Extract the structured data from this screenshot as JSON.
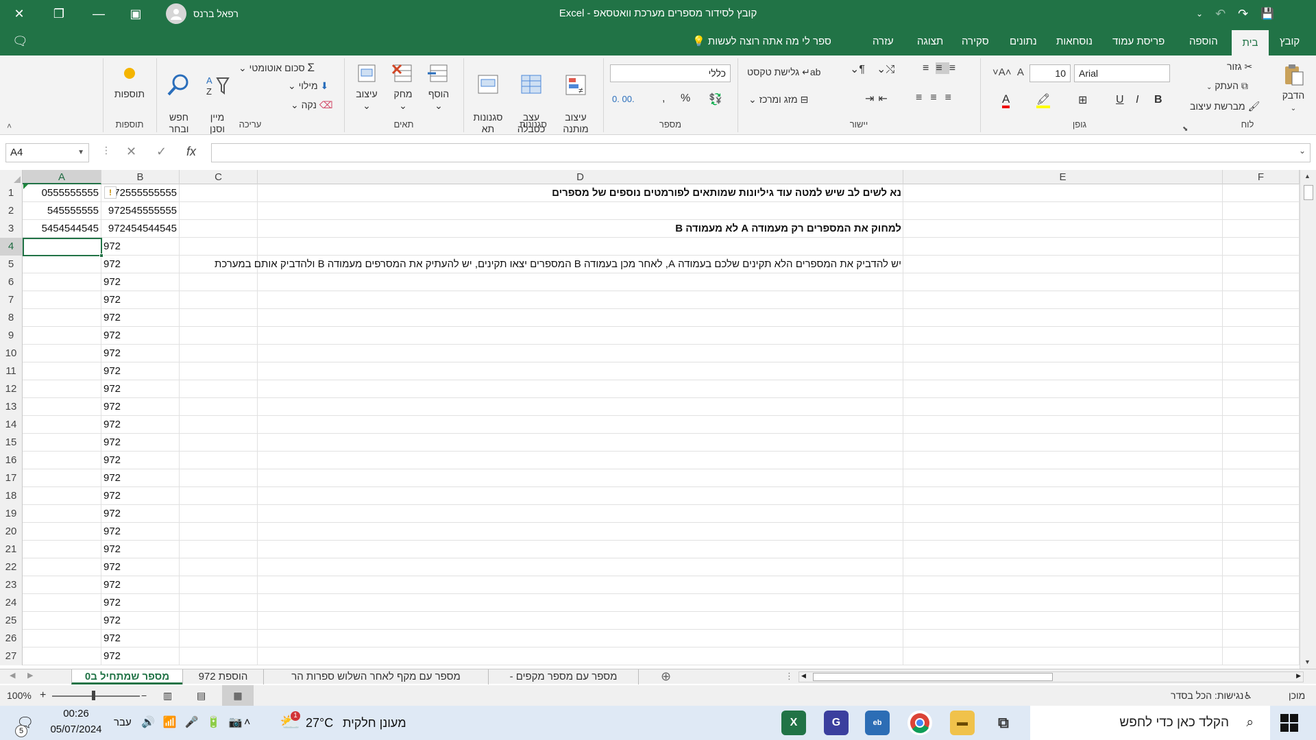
{
  "window": {
    "title": "קובץ לסידור מספרים מערכת וואטסאפ  -  Excel",
    "user": "רפאל ברנס"
  },
  "ribbon_tabs": [
    "קובץ",
    "בית",
    "הוספה",
    "פריסת עמוד",
    "נוסחאות",
    "נתונים",
    "סקירה",
    "תצוגה",
    "עזרה"
  ],
  "active_tab": "בית",
  "tell_me": "ספר לי מה אתה רוצה לעשות",
  "ribbon": {
    "clipboard": {
      "label": "לוח",
      "paste": "הדבק",
      "cut": "גזור",
      "copy": "העתק",
      "format_painter": "מברשת עיצוב"
    },
    "font": {
      "label": "גופן",
      "font_name": "Arial",
      "font_size": "10",
      "bold": "B",
      "italic": "I",
      "underline": "U"
    },
    "alignment": {
      "label": "יישור",
      "wrap_text": "גלישת טקסט",
      "merge_center": "מזג ומרכז"
    },
    "number": {
      "label": "מספר",
      "format": "כללי",
      "percent": "%",
      "comma": ","
    },
    "styles": {
      "label": "סגנונות",
      "conditional": "עיצוב\nמותנה",
      "format_table": "עצב\nכטבלה",
      "cell_styles": "סגנונות\nתא"
    },
    "cells": {
      "label": "תאים",
      "insert": "הוסף",
      "delete": "מחק",
      "format": "עיצוב"
    },
    "editing": {
      "label": "עריכה",
      "autosum": "סכום אוטומטי",
      "fill": "מילוי",
      "clear": "נקה",
      "sort_filter": "מיין\nוסנן",
      "find_select": "חפש\nובחר"
    },
    "addins": {
      "label": "תוספות",
      "addins": "תוספות"
    }
  },
  "formula_bar": {
    "name_box": "A4",
    "fx": "fx",
    "formula": ""
  },
  "columns": [
    "A",
    "B",
    "C",
    "D",
    "E",
    "F"
  ],
  "selected_column": "A",
  "selected_row": 4,
  "rows": [
    {
      "n": "1",
      "A": "0555555555",
      "B": "972555555555",
      "D": "נא לשים לב שיש למטה עוד גיליונות שמותאים לפורמטים נוספים של מספרים"
    },
    {
      "n": "2",
      "A": "545555555",
      "B": "972545555555",
      "D": ""
    },
    {
      "n": "3",
      "A": "5454544545",
      "B": "972454544545",
      "D": "למחוק את המספרים רק מעמודה A לא מעמודה B"
    },
    {
      "n": "4",
      "A": "",
      "B": "972",
      "D": ""
    },
    {
      "n": "5",
      "A": "",
      "B": "972",
      "D": "יש להדביק את המספרים הלא תקינים שלכם בעמודה A, לאחר מכן בעמודה B המספרים יצאו תקינים, יש להעתיק את המסרפים מעמודה B ולהדביק אותם במערכת"
    },
    {
      "n": "6",
      "A": "",
      "B": "972",
      "D": ""
    },
    {
      "n": "7",
      "A": "",
      "B": "972",
      "D": ""
    },
    {
      "n": "8",
      "A": "",
      "B": "972",
      "D": ""
    },
    {
      "n": "9",
      "A": "",
      "B": "972",
      "D": ""
    },
    {
      "n": "10",
      "A": "",
      "B": "972",
      "D": ""
    },
    {
      "n": "11",
      "A": "",
      "B": "972",
      "D": ""
    },
    {
      "n": "12",
      "A": "",
      "B": "972",
      "D": ""
    },
    {
      "n": "13",
      "A": "",
      "B": "972",
      "D": ""
    },
    {
      "n": "14",
      "A": "",
      "B": "972",
      "D": ""
    },
    {
      "n": "15",
      "A": "",
      "B": "972",
      "D": ""
    },
    {
      "n": "16",
      "A": "",
      "B": "972",
      "D": ""
    },
    {
      "n": "17",
      "A": "",
      "B": "972",
      "D": ""
    },
    {
      "n": "18",
      "A": "",
      "B": "972",
      "D": ""
    },
    {
      "n": "19",
      "A": "",
      "B": "972",
      "D": ""
    },
    {
      "n": "20",
      "A": "",
      "B": "972",
      "D": ""
    },
    {
      "n": "21",
      "A": "",
      "B": "972",
      "D": ""
    },
    {
      "n": "22",
      "A": "",
      "B": "972",
      "D": ""
    },
    {
      "n": "23",
      "A": "",
      "B": "972",
      "D": ""
    },
    {
      "n": "24",
      "A": "",
      "B": "972",
      "D": ""
    },
    {
      "n": "25",
      "A": "",
      "B": "972",
      "D": ""
    },
    {
      "n": "26",
      "A": "",
      "B": "972",
      "D": ""
    },
    {
      "n": "27",
      "A": "",
      "B": "972",
      "D": ""
    }
  ],
  "sheets": [
    {
      "name": "מספר שמתחיל ב0",
      "active": true
    },
    {
      "name": "הוספת 972",
      "active": false
    },
    {
      "name": "מספר עם מקף לאחר השלוש ספרות הר",
      "active": false
    },
    {
      "name": "מספר עם מספר מקפים -",
      "active": false
    }
  ],
  "status": {
    "ready": "מוכן",
    "accessibility": "נגישות: הכל בסדר",
    "zoom": "100%"
  },
  "taskbar": {
    "search_placeholder": "הקלד כאן כדי לחפש",
    "weather": "מעונן חלקית",
    "temperature": "27°C",
    "language": "עבר",
    "time": "00:26",
    "date": "05/07/2024",
    "notifications": "5",
    "weather_badge": "1"
  }
}
